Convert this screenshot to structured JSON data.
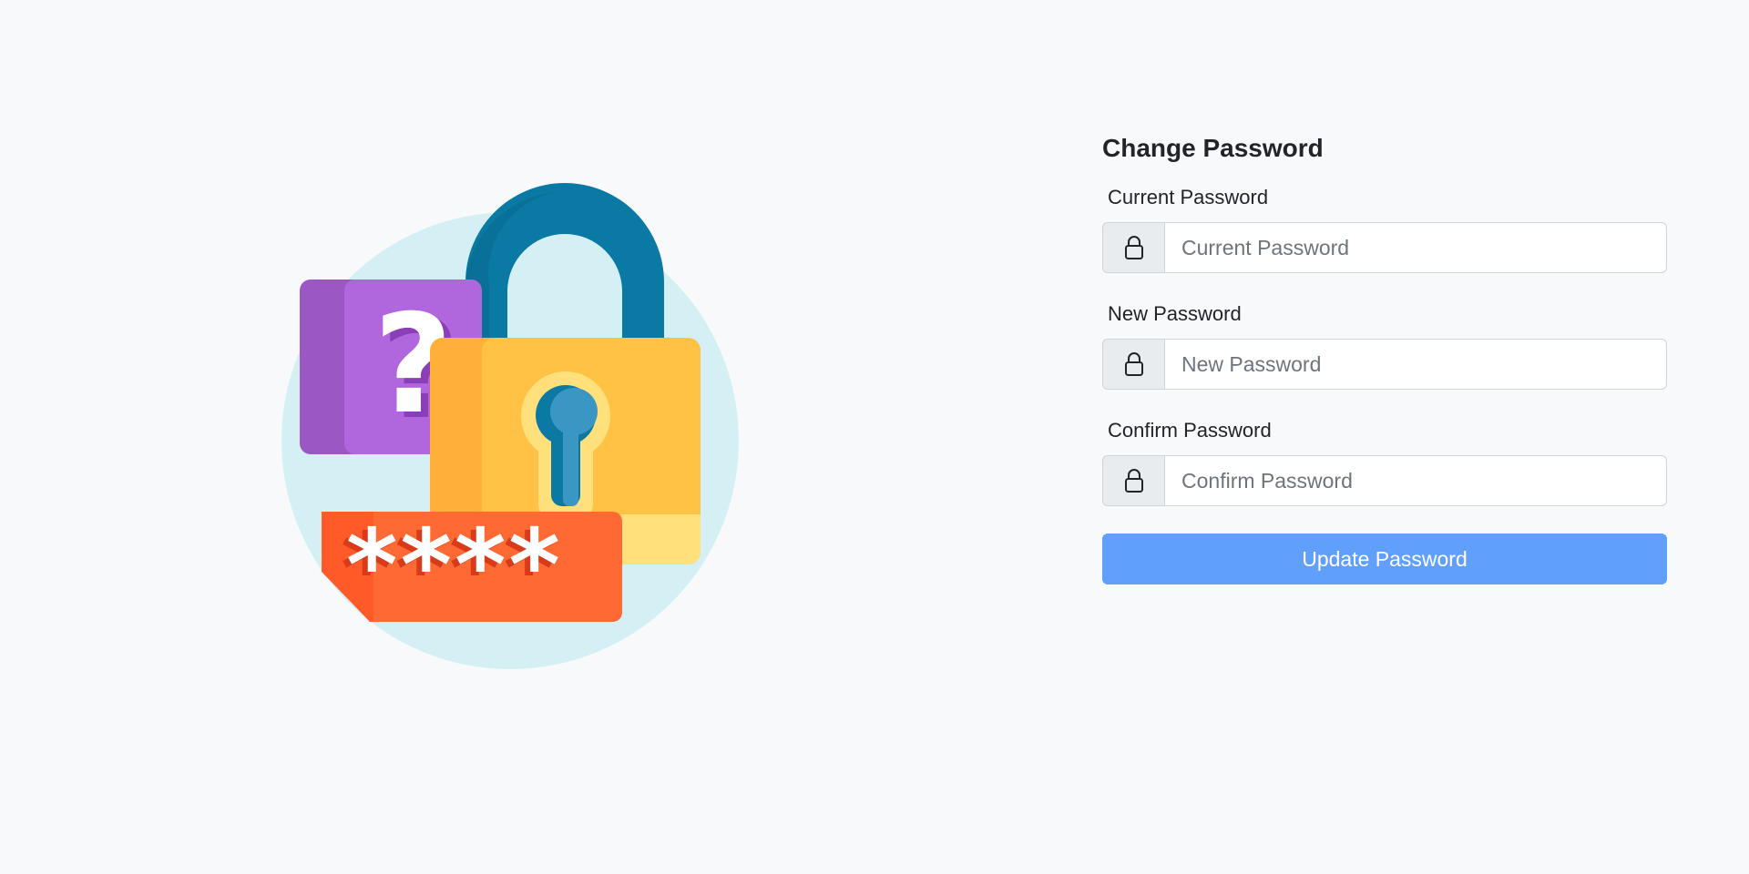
{
  "form": {
    "title": "Change Password",
    "fields": [
      {
        "label": "Current Password",
        "placeholder": "Current Password",
        "value": "",
        "icon": "lock-icon"
      },
      {
        "label": "New Password",
        "placeholder": "New Password",
        "value": "",
        "icon": "lock-icon"
      },
      {
        "label": "Confirm Password",
        "placeholder": "Confirm Password",
        "value": "",
        "icon": "lock-icon"
      }
    ],
    "submit_label": "Update Password"
  },
  "illustration": {
    "icon": "padlock-password-illustration",
    "masked_text": "****",
    "question_mark": "?"
  },
  "colors": {
    "background": "#f8f9fa",
    "button": "#60a0fc",
    "circle": "#d4f0f4",
    "shackle": "#0c86b0",
    "lock_body": "#ffc244",
    "question_card": "#b066dc",
    "password_card": "#ff6a34"
  }
}
